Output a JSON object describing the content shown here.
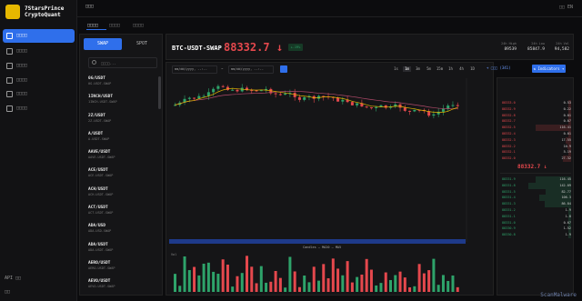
{
  "app": {
    "title_line1": "7StarsPrince",
    "title_line2": "CryptoQuant",
    "header_label": "□□□",
    "top_right": "□□ EN"
  },
  "nav": [
    {
      "label": "□□□□",
      "name": "dashboard"
    },
    {
      "label": "□□□□",
      "name": "markets"
    },
    {
      "label": "□□□□",
      "name": "portfolio"
    },
    {
      "label": "□□□□",
      "name": "orders"
    },
    {
      "label": "□□□□",
      "name": "signals"
    },
    {
      "label": "□□□□",
      "name": "account"
    }
  ],
  "sidebar_bottom": {
    "api": "API □□",
    "settings": "□□"
  },
  "tabs": [
    {
      "label": "□□□□"
    },
    {
      "label": "□□□□"
    },
    {
      "label": "□□□□"
    }
  ],
  "market": {
    "swap_tab": "SWAP",
    "spot_tab": "SPOT",
    "search_placeholder": "□□□□..."
  },
  "symbols": [
    {
      "s": "0G/USDT",
      "d": "0G-USDT-SWAP"
    },
    {
      "s": "1INCH/USDT",
      "d": "1INCH-USDT-SWAP"
    },
    {
      "s": "2Z/USDT",
      "d": "2Z-USDT-SWAP"
    },
    {
      "s": "A/USDT",
      "d": "A-USDT-SWAP"
    },
    {
      "s": "AAVE/USDT",
      "d": "AAVE-USDT-SWAP"
    },
    {
      "s": "ACE/USDT",
      "d": "ACE-USDT-SWAP"
    },
    {
      "s": "ACH/USDT",
      "d": "ACH-USDT-SWAP"
    },
    {
      "s": "ACT/USDT",
      "d": "ACT-USDT-SWAP"
    },
    {
      "s": "ADA/USD",
      "d": "ADA-USD-SWAP"
    },
    {
      "s": "ADA/USDT",
      "d": "ADA-USDT-SWAP"
    },
    {
      "s": "AERO/USDT",
      "d": "AERO-USDT-SWAP"
    },
    {
      "s": "AEVO/USDT",
      "d": "AEVO-USDT-SWAP"
    }
  ],
  "ticker": {
    "symbol": "BTC-USDT-SWAP",
    "price": "88332.7",
    "arrow": "↓",
    "change": "+.19%",
    "high_label": "24h High",
    "high": "89539",
    "low_label": "24h Low",
    "low": "85847.9",
    "vol_label": "24h Vol",
    "vol": "94,582"
  },
  "toolbar": {
    "date_start": "mm/dd/yyyy, --:--",
    "date_sep": "~",
    "date_end": "mm/dd/yyyy, --:--",
    "timeframes": [
      "1s",
      "1m",
      "3m",
      "5m",
      "15m",
      "1h",
      "4h",
      "1D"
    ],
    "active_tf": "1m",
    "bookmark": "+ □□□ (341)",
    "indicators": "⇅ Indicators ▾"
  },
  "legend": {
    "a": "Candles",
    "b": "MA20",
    "c": "MA5"
  },
  "vol_label": "Vol",
  "orderbook": {
    "mid_price": "88332.7 ↓",
    "asks": [
      {
        "p": "88333.0",
        "q": "0.53"
      },
      {
        "p": "88332.9",
        "q": "0.22"
      },
      {
        "p": "88332.8",
        "q": "0.01"
      },
      {
        "p": "88332.7",
        "q": "0.07"
      },
      {
        "p": "88332.5",
        "q": "116.41"
      },
      {
        "p": "88332.4",
        "q": "0.01"
      },
      {
        "p": "88332.3",
        "q": "17.55"
      },
      {
        "p": "88332.2",
        "q": "10.9"
      },
      {
        "p": "88332.1",
        "q": "5.19"
      },
      {
        "p": "88332.0",
        "q": "27.32"
      }
    ],
    "bids": [
      {
        "p": "88331.9",
        "q": "116.45"
      },
      {
        "p": "88331.8",
        "q": "142.09"
      },
      {
        "p": "88331.5",
        "q": "82.77"
      },
      {
        "p": "88331.4",
        "q": "106.3"
      },
      {
        "p": "88331.3",
        "q": "86.84"
      },
      {
        "p": "88331.2",
        "q": "1.9"
      },
      {
        "p": "88331.1",
        "q": "1.8"
      },
      {
        "p": "88331.0",
        "q": "0.67"
      },
      {
        "p": "88330.9",
        "q": "1.52"
      },
      {
        "p": "88330.8",
        "q": "1.9"
      }
    ]
  },
  "watermark": "ScanMalware"
}
